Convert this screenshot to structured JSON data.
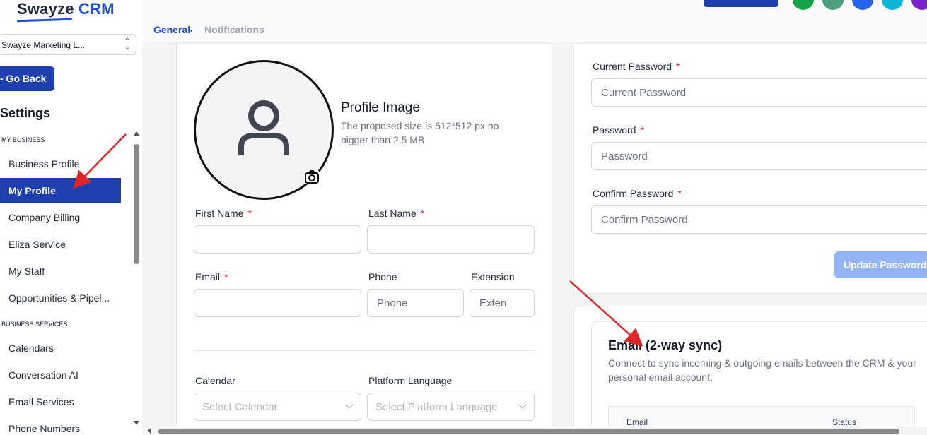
{
  "brand": {
    "name_part1": "Swayze",
    "name_part2": "CRM"
  },
  "account_selector": {
    "value": "Swayze Marketing L..."
  },
  "go_back_label": "- Go Back",
  "settings_title": "Settings",
  "sidebar": {
    "sections": [
      {
        "label": "MY BUSINESS",
        "items": [
          "Business Profile",
          "My Profile",
          "Company Billing",
          "Eliza Service",
          "My Staff",
          "Opportunities & Pipel..."
        ]
      },
      {
        "label": "BUSINESS SERVICES",
        "items": [
          "Calendars",
          "Conversation AI",
          "Email Services",
          "Phone Numbers"
        ]
      }
    ],
    "active_item": "My Profile"
  },
  "tabs": {
    "general": "General",
    "notifications": "Notifications"
  },
  "profile": {
    "image_title": "Profile Image",
    "image_hint": "The proposed size is 512*512 px no bigger than 2.5 MB"
  },
  "form": {
    "first_name_label": "First Name",
    "last_name_label": "Last Name",
    "email_label": "Email",
    "phone_label": "Phone",
    "phone_placeholder": "Phone",
    "extension_label": "Extension",
    "extension_placeholder": "Exten",
    "calendar_label": "Calendar",
    "calendar_placeholder": "Select Calendar",
    "language_label": "Platform Language",
    "language_placeholder": "Select Platform Language",
    "required_mark": "*"
  },
  "password": {
    "current_label": "Current Password",
    "current_placeholder": "Current Password",
    "new_label": "Password",
    "new_placeholder": "Password",
    "confirm_label": "Confirm Password",
    "confirm_placeholder": "Confirm Password",
    "update_button": "Update Password"
  },
  "email_sync": {
    "title": "Email (2-way sync)",
    "description": "Connect to sync incoming & outgoing emails between the CRM & your personal email account.",
    "columns": [
      "Email",
      "Status"
    ]
  },
  "colors": {
    "primary": "#1e40af",
    "link": "#1d4ed8",
    "required": "#dc2626",
    "annotation_arrow": "#e02424",
    "circle_buttons": [
      "#16a34a",
      "#4b9e7a",
      "#2563eb",
      "#06b6d4",
      "#7e22ce"
    ]
  }
}
